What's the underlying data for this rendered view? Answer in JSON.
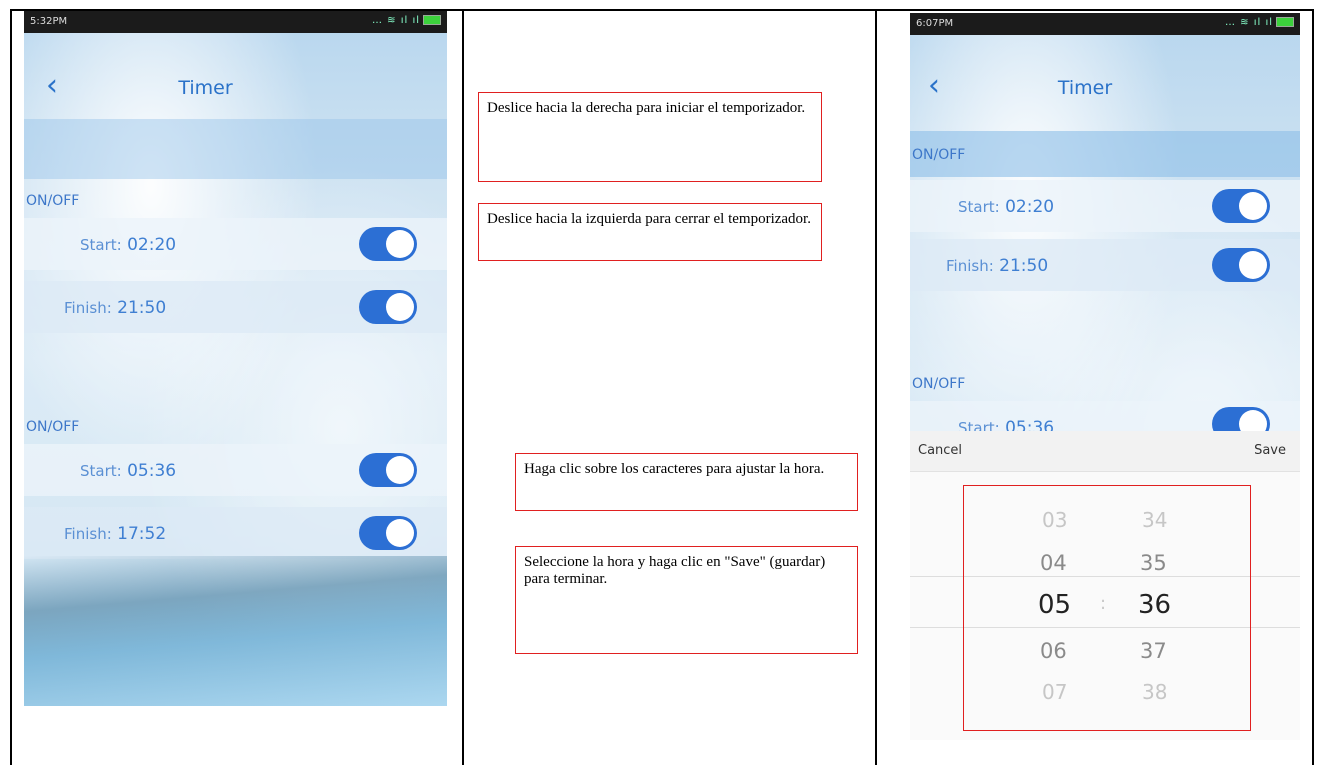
{
  "left_phone": {
    "status_time": "5:32PM",
    "title": "Timer",
    "groups": [
      {
        "label": "ON/OFF",
        "start_key": "Start:",
        "start_value": "02:20",
        "finish_key": "Finish:",
        "finish_value": "21:50"
      },
      {
        "label": "ON/OFF",
        "start_key": "Start:",
        "start_value": "05:36",
        "finish_key": "Finish:",
        "finish_value": "17:52"
      }
    ]
  },
  "annotations": {
    "slide_right": "Deslice hacia la derecha para iniciar el temporizador.",
    "slide_left": "Deslice hacia la izquierda para cerrar el temporizador.",
    "click_chars": "Haga clic sobre los caracteres para ajustar la hora.",
    "select_save": "Seleccione la hora y haga clic en \"Save\" (guardar) para terminar."
  },
  "right_phone": {
    "status_time": "6:07PM",
    "title": "Timer",
    "groups": [
      {
        "label": "ON/OFF",
        "start_key": "Start:",
        "start_value": "02:20",
        "finish_key": "Finish:",
        "finish_value": "21:50"
      },
      {
        "label": "ON/OFF",
        "start_key": "Start:",
        "start_value": "05:36"
      }
    ],
    "picker": {
      "cancel": "Cancel",
      "save": "Save",
      "hours": [
        "03",
        "04",
        "05",
        "06",
        "07"
      ],
      "minutes": [
        "34",
        "35",
        "36",
        "37",
        "38"
      ],
      "separator": ":"
    }
  },
  "colors": {
    "accent": "#2c6fd4",
    "annotation_border": "#e02020"
  }
}
